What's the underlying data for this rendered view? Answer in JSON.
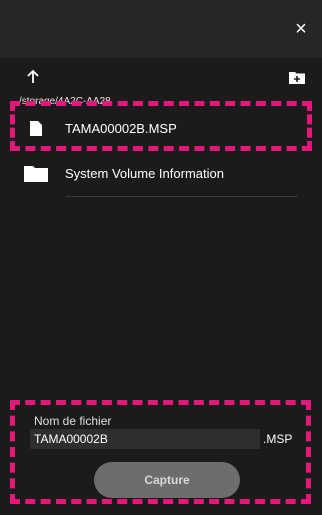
{
  "header": {
    "close_icon": "close-icon",
    "close_glyph": "×"
  },
  "nav": {
    "up_icon": "arrow-up-icon",
    "new_folder_icon": "new-folder-icon",
    "path": "/storage/4A2C-AA28"
  },
  "files": [
    {
      "name": "TAMA00002B.MSP",
      "icon": "file-icon"
    },
    {
      "name": "System Volume Information",
      "icon": "folder-icon"
    }
  ],
  "save": {
    "filename_label": "Nom de fichier",
    "filename_value": "TAMA00002B",
    "extension": ".MSP",
    "capture_label": "Capture"
  },
  "colors": {
    "highlight": "#e5177a",
    "background": "#1b1b1b"
  }
}
